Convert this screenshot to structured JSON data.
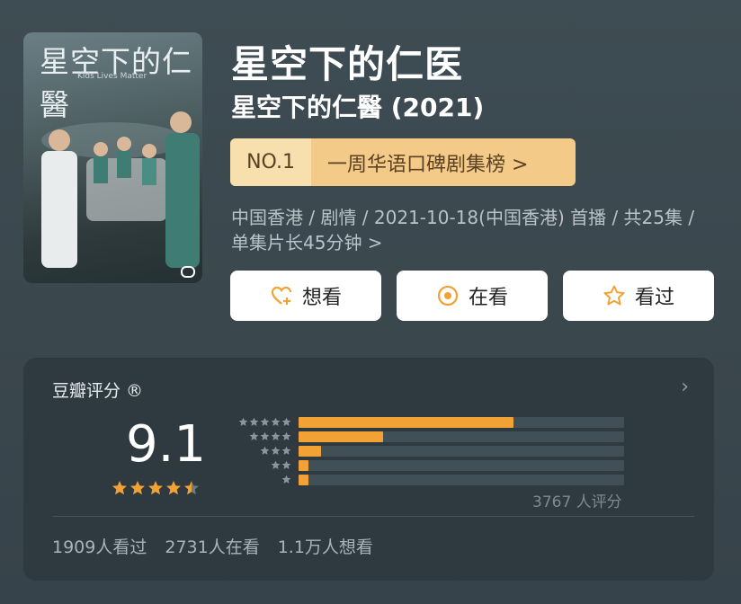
{
  "poster": {
    "title": "星空下的仁醫",
    "subtitle": "Kids Lives Matter"
  },
  "header": {
    "title": "星空下的仁医",
    "original_title": "星空下的仁醫 (2021)",
    "rank_no": "NO.1",
    "rank_label": "一周华语口碑剧集榜 >",
    "meta": "中国香港 / 剧情 / 2021-10-18(中国香港) 首播 / 共25集 / 单集片长45分钟 >"
  },
  "actions": {
    "want": "想看",
    "doing": "在看",
    "done": "看过"
  },
  "rating": {
    "label": "豆瓣评分 ®",
    "score": "9.1",
    "stars_value": 4.5,
    "distribution": [
      0.66,
      0.26,
      0.07,
      0.03,
      0.03
    ],
    "count_label": "3767 人评分"
  },
  "stats": {
    "watched": "1909人看过",
    "watching": "2731人在看",
    "want": "1.1万人想看"
  },
  "colors": {
    "accent": "#f2a234",
    "rank_bg": "#f4ca89",
    "panel": "#2e3a40"
  },
  "icons": [
    "heart-plus-icon",
    "target-icon",
    "star-outline-icon",
    "chevron-right-icon"
  ]
}
